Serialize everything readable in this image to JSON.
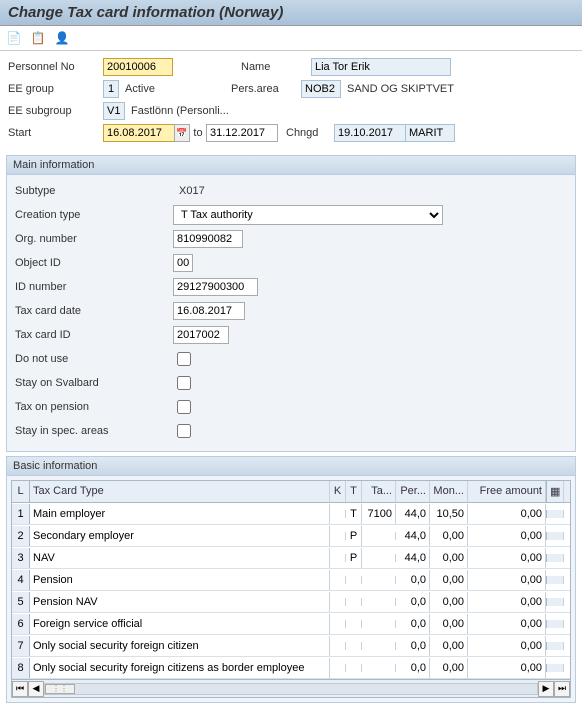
{
  "title": "Change Tax card information (Norway)",
  "header": {
    "personnel_no_lbl": "Personnel No",
    "personnel_no": "20010006",
    "name_lbl": "Name",
    "name": "Lia Tor Erik",
    "ee_group_lbl": "EE group",
    "ee_group_code": "1",
    "ee_group_text": "Active",
    "pers_area_lbl": "Pers.area",
    "pers_area_code": "NOB2",
    "pers_area_text": "SAND OG SKIPTVET",
    "ee_subgroup_lbl": "EE subgroup",
    "ee_subgroup_code": "V1",
    "ee_subgroup_text": "Fastlönn (Personli...",
    "start_lbl": "Start",
    "start": "16.08.2017",
    "to_lbl": "to",
    "to": "31.12.2017",
    "chngd_lbl": "Chngd",
    "chngd": "19.10.2017",
    "chngd_by": "MARIT"
  },
  "main_info": {
    "title": "Main information",
    "subtype_lbl": "Subtype",
    "subtype": "X017",
    "creation_type_lbl": "Creation type",
    "creation_type": "T Tax authority",
    "org_number_lbl": "Org. number",
    "org_number": "810990082",
    "object_id_lbl": "Object ID",
    "object_id": "00",
    "id_number_lbl": "ID number",
    "id_number": "29127900300",
    "tax_card_date_lbl": "Tax card date",
    "tax_card_date": "16.08.2017",
    "tax_card_id_lbl": "Tax card ID",
    "tax_card_id": "2017002",
    "do_not_use_lbl": "Do not use",
    "svalbard_lbl": "Stay on Svalbard",
    "pension_lbl": "Tax on pension",
    "spec_lbl": "Stay in spec. areas"
  },
  "basic_info": {
    "title": "Basic information",
    "cols": {
      "l": "L",
      "type": "Tax Card Type",
      "k": "K",
      "t": "T",
      "ta": "Ta...",
      "per": "Per...",
      "mon": "Mon...",
      "free": "Free amount"
    },
    "rows": [
      {
        "n": "1",
        "type": "Main employer",
        "k": "",
        "t": "T",
        "ta": "7100",
        "per": "44,0",
        "mon": "10,50",
        "free": "0,00"
      },
      {
        "n": "2",
        "type": "Secondary employer",
        "k": "",
        "t": "P",
        "ta": "",
        "per": "44,0",
        "mon": "0,00",
        "free": "0,00"
      },
      {
        "n": "3",
        "type": "NAV",
        "k": "",
        "t": "P",
        "ta": "",
        "per": "44,0",
        "mon": "0,00",
        "free": "0,00"
      },
      {
        "n": "4",
        "type": "Pension",
        "k": "",
        "t": "",
        "ta": "",
        "per": "0,0",
        "mon": "0,00",
        "free": "0,00"
      },
      {
        "n": "5",
        "type": "Pension NAV",
        "k": "",
        "t": "",
        "ta": "",
        "per": "0,0",
        "mon": "0,00",
        "free": "0,00"
      },
      {
        "n": "6",
        "type": "Foreign service official",
        "k": "",
        "t": "",
        "ta": "",
        "per": "0,0",
        "mon": "0,00",
        "free": "0,00"
      },
      {
        "n": "7",
        "type": "Only social security foreign citizen",
        "k": "",
        "t": "",
        "ta": "",
        "per": "0,0",
        "mon": "0,00",
        "free": "0,00"
      },
      {
        "n": "8",
        "type": "Only social security foreign citizens as border employee",
        "k": "",
        "t": "",
        "ta": "",
        "per": "0,0",
        "mon": "0,00",
        "free": "0,00"
      }
    ]
  }
}
